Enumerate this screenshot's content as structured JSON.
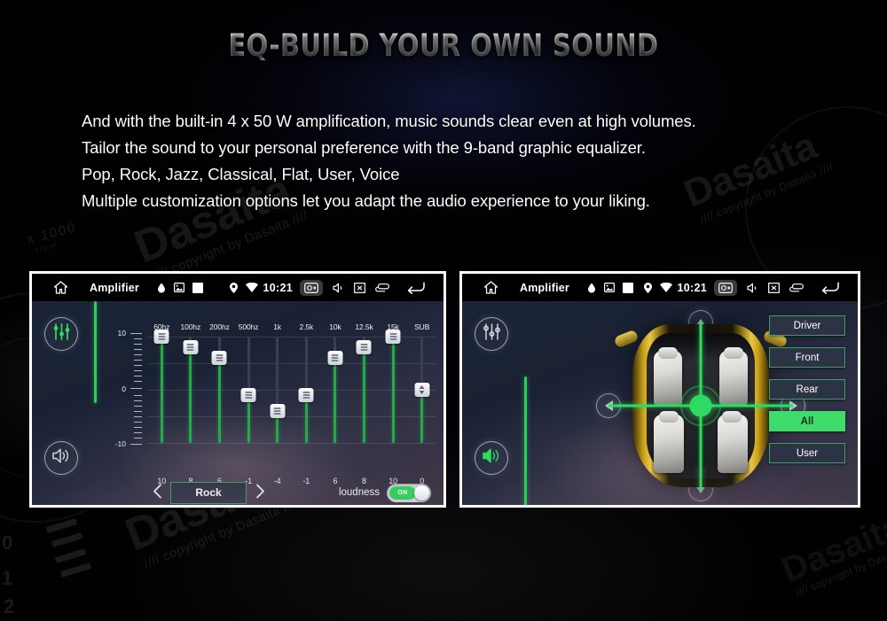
{
  "headline": "EQ-BUILD YOUR OWN SOUND",
  "body_lines": [
    "And with the built-in 4 x 50 W amplification, music sounds clear even at high volumes.",
    "Tailor the sound to your personal preference with the 9-band graphic equalizer.",
    "Pop, Rock, Jazz, Classical, Flat, User, Voice",
    "Multiple customization options let you adapt the audio experience to your liking."
  ],
  "watermark": {
    "brand": "Dasaita",
    "sub": "//// copyright by Dasaita ////"
  },
  "background": {
    "rpm_number": "x 1000",
    "rpm_unit": "r/pm",
    "gauge_digits": [
      "0",
      "1",
      "2"
    ]
  },
  "colors": {
    "accent_green": "#2ddb62",
    "slider_green": "#27a74a",
    "button_border": "#3f9e63",
    "button_fill": "#2b3345",
    "selected_fill": "#3fdc6b",
    "panel_dark": "#1b2436"
  },
  "statusbar": {
    "home_icon": "home-icon",
    "title": "Amplifier",
    "left_icons": [
      "droplet-icon",
      "image-icon",
      "square-icon"
    ],
    "location_icon": "location-pin-icon",
    "wifi_icon": "wifi-icon",
    "time": "10:21",
    "screenshot_icon": "screenshot-icon",
    "mute_icon": "volume-mute-icon",
    "display_icon": "display-off-icon",
    "multiwindow_icon": "multi-window-icon",
    "back_icon": "back-arrow-icon"
  },
  "left_screen": {
    "rail": {
      "equalizer_icon": "equalizer-sliders-icon",
      "equalizer_active": true,
      "balance_icon": "speaker-balance-icon",
      "balance_active": false
    },
    "equalizer": {
      "scale_labels": [
        "10",
        "0",
        "-10"
      ],
      "bands": [
        {
          "name": "60hz",
          "value": 10
        },
        {
          "name": "100hz",
          "value": 8
        },
        {
          "name": "200hz",
          "value": 6
        },
        {
          "name": "500hz",
          "value": -1
        },
        {
          "name": "1k",
          "value": -4
        },
        {
          "name": "2.5k",
          "value": -1
        },
        {
          "name": "10k",
          "value": 6
        },
        {
          "name": "12.5k",
          "value": 8
        },
        {
          "name": "15k",
          "value": 10
        },
        {
          "name": "SUB",
          "value": 0
        }
      ],
      "range": [
        -10,
        10
      ],
      "preset": "Rock",
      "prev_icon": "chevron-left-icon",
      "next_icon": "chevron-right-icon",
      "loudness_label": "loudness",
      "loudness_state": "ON"
    }
  },
  "right_screen": {
    "rail": {
      "equalizer_icon": "equalizer-sliders-icon",
      "equalizer_active": false,
      "balance_icon": "speaker-balance-icon",
      "balance_active": true
    },
    "balance": {
      "car_diagram": "car-top-view-seats",
      "crosshair_position": "center",
      "dpad": {
        "up": "arrow-up-icon",
        "down": "arrow-down-icon",
        "left": "arrow-left-icon",
        "right": "arrow-right-icon"
      },
      "zones": [
        {
          "label": "Driver",
          "selected": false
        },
        {
          "label": "Front",
          "selected": false
        },
        {
          "label": "Rear",
          "selected": false
        },
        {
          "label": "All",
          "selected": true
        },
        {
          "label": "User",
          "selected": false
        }
      ]
    }
  }
}
